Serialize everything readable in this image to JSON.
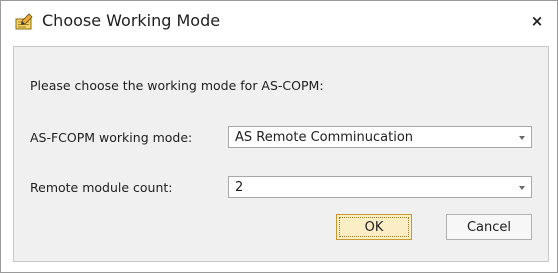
{
  "dialog": {
    "title": "Choose Working Mode",
    "close_symbol": "×",
    "icon": "edit-document-icon",
    "prompt": "Please choose the working mode for AS-COPM:"
  },
  "fields": {
    "working_mode": {
      "label": "AS-FCOPM working mode:",
      "value": "AS Remote Comminucation"
    },
    "module_count": {
      "label": "Remote module count:",
      "value": "2"
    }
  },
  "buttons": {
    "ok": "OK",
    "cancel": "Cancel"
  },
  "colors": {
    "content_bg": "#f0f0f0",
    "ok_button_bg": "#fbeec4",
    "ok_button_border": "#c79a31"
  }
}
